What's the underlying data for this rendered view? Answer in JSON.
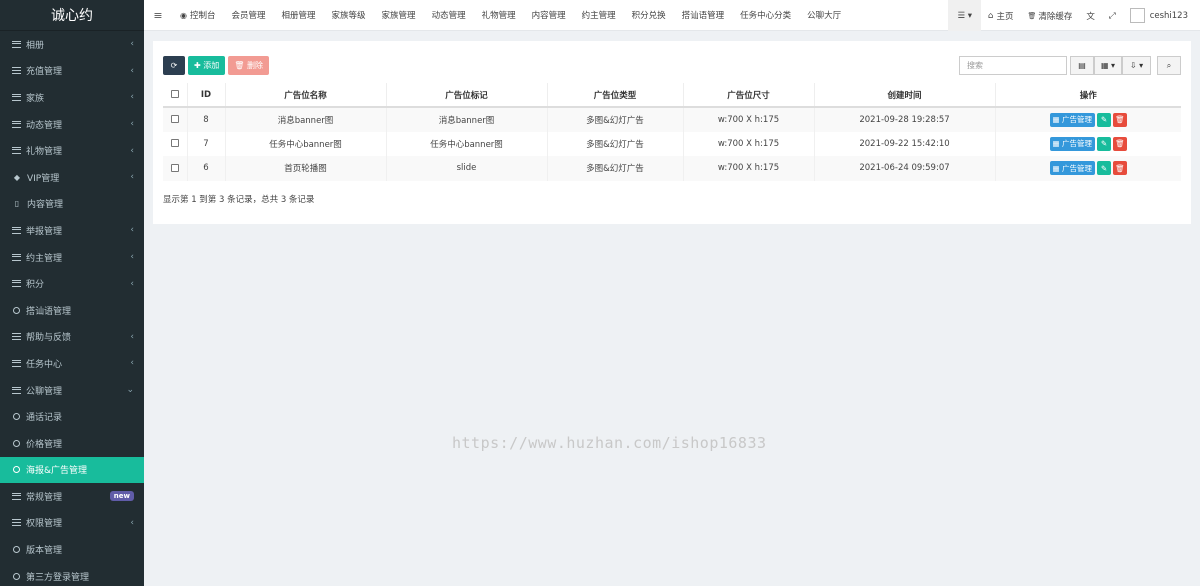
{
  "app": {
    "logo": "诚心约"
  },
  "sidebar": {
    "items": [
      {
        "label": "相册",
        "icon": "bars-icon",
        "chev": "‹"
      },
      {
        "label": "充值管理",
        "icon": "bars-icon",
        "chev": "‹"
      },
      {
        "label": "家族",
        "icon": "bars-icon",
        "chev": "‹"
      },
      {
        "label": "动态管理",
        "icon": "bars-icon",
        "chev": "‹"
      },
      {
        "label": "礼物管理",
        "icon": "bars-icon",
        "chev": "‹"
      },
      {
        "label": "VIP管理",
        "icon": "diamond-icon",
        "chev": "‹"
      },
      {
        "label": "内容管理",
        "icon": "file-icon",
        "chev": ""
      },
      {
        "label": "举报管理",
        "icon": "bars-icon",
        "chev": "‹"
      },
      {
        "label": "约主管理",
        "icon": "bars-icon",
        "chev": "‹"
      },
      {
        "label": "积分",
        "icon": "bars-icon",
        "chev": "‹"
      },
      {
        "label": "搭讪语管理",
        "icon": "circle-icon",
        "chev": ""
      },
      {
        "label": "帮助与反馈",
        "icon": "bars-icon",
        "chev": "‹"
      },
      {
        "label": "任务中心",
        "icon": "bars-icon",
        "chev": "‹"
      },
      {
        "label": "公聊管理",
        "icon": "bars-icon",
        "chev": "⌄"
      },
      {
        "label": "通话记录",
        "icon": "circle-icon",
        "chev": ""
      },
      {
        "label": "价格管理",
        "icon": "circle-icon",
        "chev": ""
      },
      {
        "label": "海报&广告管理",
        "icon": "circle-icon",
        "chev": "",
        "active": true
      },
      {
        "label": "常规管理",
        "icon": "bars-icon",
        "chev": "",
        "badge": "new"
      },
      {
        "label": "权限管理",
        "icon": "bars-icon",
        "chev": "‹"
      },
      {
        "label": "版本管理",
        "icon": "circle-icon",
        "chev": ""
      },
      {
        "label": "第三方登录管理",
        "icon": "circle-icon",
        "chev": ""
      }
    ]
  },
  "topbar": {
    "toggle": "≡",
    "tabs": [
      {
        "label": "控制台",
        "icon": "dashboard-icon",
        "glyph": "◉"
      },
      {
        "label": "会员管理"
      },
      {
        "label": "相册管理"
      },
      {
        "label": "家族等级"
      },
      {
        "label": "家族管理"
      },
      {
        "label": "动态管理"
      },
      {
        "label": "礼物管理"
      },
      {
        "label": "内容管理"
      },
      {
        "label": "约主管理"
      },
      {
        "label": "积分兑换"
      },
      {
        "label": "搭讪语管理"
      },
      {
        "label": "任务中心分类"
      },
      {
        "label": "公聊大厅"
      }
    ],
    "menu_glyph": "☰ ▾",
    "home": "主页",
    "home_glyph": "⌂",
    "clear_cache": "清除缓存",
    "clear_glyph": "🗑",
    "translate_glyph": "文",
    "fullscreen_glyph": "⤢",
    "username": "ceshi123"
  },
  "toolbar": {
    "refresh_glyph": "⟳",
    "add_label": "✚ 添加",
    "delete_label": "🗑 删除",
    "search_placeholder": "搜索",
    "toggle_glyph": "▤",
    "columns_glyph": "▦ ▾",
    "export_glyph": "⇩ ▾",
    "search_glyph": "⌕"
  },
  "table": {
    "headers": [
      "ID",
      "广告位名称",
      "广告位标记",
      "广告位类型",
      "广告位尺寸",
      "创建时间",
      "操作"
    ],
    "rows": [
      {
        "id": "8",
        "name": "消息banner图",
        "mark": "消息banner图",
        "type": "多图&幻灯广告",
        "size": "w:700 X h:175",
        "created": "2021-09-28 19:28:57"
      },
      {
        "id": "7",
        "name": "任务中心banner图",
        "mark": "任务中心banner图",
        "type": "多图&幻灯广告",
        "size": "w:700 X h:175",
        "created": "2021-09-22 15:42:10"
      },
      {
        "id": "6",
        "name": "首页轮播图",
        "mark": "slide",
        "type": "多图&幻灯广告",
        "size": "w:700 X h:175",
        "created": "2021-06-24 09:59:07"
      }
    ],
    "op_manage": "▦ 广告管理",
    "op_edit": "✎",
    "op_delete": "🗑"
  },
  "summary": "显示第 1 到第 3 条记录，总共 3 条记录",
  "watermark": "https://www.huzhan.com/ishop16833"
}
